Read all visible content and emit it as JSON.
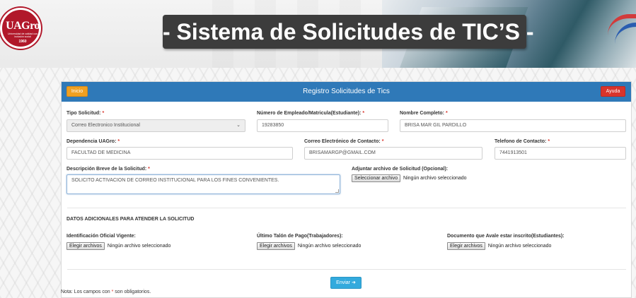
{
  "header": {
    "logo_text": "UAGro",
    "logo_subtitle": "Universidad de calidad con inclusión social",
    "logo_year": "1960",
    "title": "- Sistema de Solicitudes de TIC’S -"
  },
  "panel": {
    "title": "Registro Solicitudes de Tics",
    "inicio_label": "Inicio",
    "ayuda_label": "Ayuda"
  },
  "colors": {
    "panel_header": "#2f79b8",
    "inicio_button": "#f0a022",
    "ayuda_button": "#d9342b",
    "enviar_button": "#33aadd",
    "required_marker": "#d9342b"
  },
  "required_marker": "*",
  "form": {
    "tipo_solicitud": {
      "label": "Tipo Solicitud:",
      "value": "Correo Electronico Institucional"
    },
    "numero_empleado": {
      "label": "Número de Empleado/Matricula(Estudiante):",
      "value": "19283850"
    },
    "nombre_completo": {
      "label": "Nombre Completo:",
      "value": "BRISA MAR GIL PARDILLO"
    },
    "dependencia": {
      "label": "Dependencia UAGro:",
      "value": "FACULTAD DE MEDICINA"
    },
    "correo_contacto": {
      "label": "Correo Electrónico de Contacto:",
      "value": "BRISAMARGP@GMAIL.COM"
    },
    "telefono_contacto": {
      "label": "Telefono de Contacto:",
      "value": "7441913501"
    },
    "descripcion": {
      "label": "Descripción Breve de la Solicitud:",
      "value": "SOLICITO ACTIVACION DE CORREO INSTITUCIONAL PARA LOS FINES CONVENIENTES."
    },
    "adjunto": {
      "label": "Adjuntar archivo de Solicitud (Opcional):",
      "button": "Seleccionar archivo",
      "status": "Ningún archivo seleccionado"
    }
  },
  "additional": {
    "section_title": "DATOS ADICIONALES PARA ATENDER LA SOLICITUD",
    "items": [
      {
        "label": "Identificación Oficial Vigente:",
        "button": "Elegir archivos",
        "status": "Ningún archivo seleccionado"
      },
      {
        "label": "Último Talón de Pago(Trabajadores):",
        "button": "Elegir archivos",
        "status": "Ningún archivo seleccionado"
      },
      {
        "label": "Documento que Avale estar inscrito(Estudiantes):",
        "button": "Elegir archivos",
        "status": "Ningún archivo seleccionado"
      }
    ]
  },
  "submit": {
    "label": "Enviar",
    "icon": "arrow-right-icon"
  },
  "footer": {
    "note_prefix": "Nota: Los campos con",
    "note_suffix": "son obligatorios."
  }
}
